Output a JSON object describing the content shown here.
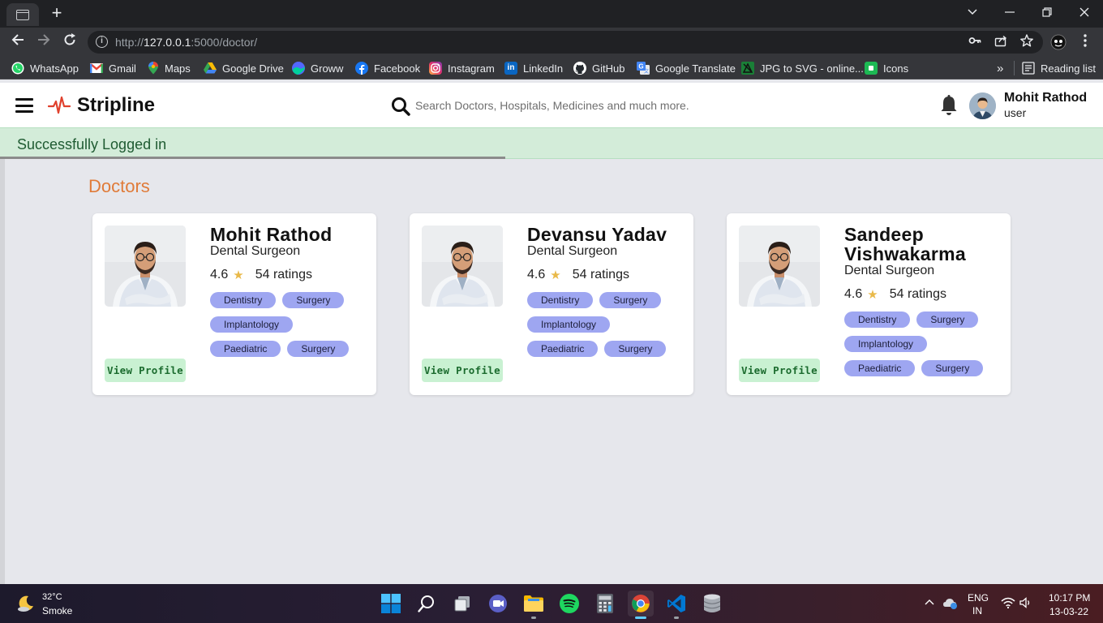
{
  "browser": {
    "url_scheme": "http://",
    "url_host": "127.0.0.1",
    "url_path": ":5000/doctor/",
    "bookmarks": [
      {
        "label": "WhatsApp"
      },
      {
        "label": "Gmail"
      },
      {
        "label": "Maps"
      },
      {
        "label": "Google Drive"
      },
      {
        "label": "Groww"
      },
      {
        "label": "Facebook"
      },
      {
        "label": "Instagram"
      },
      {
        "label": "LinkedIn"
      },
      {
        "label": "GitHub"
      },
      {
        "label": "Google Translate"
      },
      {
        "label": "JPG to SVG - online..."
      },
      {
        "label": "Icons"
      }
    ],
    "overflow_label": "»",
    "reading_list_label": "Reading list"
  },
  "header": {
    "brand": "Stripline",
    "search_placeholder": "Search Doctors, Hospitals, Medicines and much more.",
    "user_name": "Mohit Rathod",
    "user_role": "user"
  },
  "alert": {
    "message": "Successfully Logged in",
    "progress_fraction": 0.458
  },
  "main": {
    "section_title": "Doctors",
    "doctors": [
      {
        "name": "Mohit Rathod",
        "specialty": "Dental Surgeon",
        "rating": "4.6",
        "ratings_count": "54 ratings",
        "tags": [
          "Dentistry",
          "Surgery",
          "Implantology",
          "Paediatric",
          "Surgery"
        ],
        "button_label": "View Profile"
      },
      {
        "name": "Devansu Yadav",
        "specialty": "Dental Surgeon",
        "rating": "4.6",
        "ratings_count": "54 ratings",
        "tags": [
          "Dentistry",
          "Surgery",
          "Implantology",
          "Paediatric",
          "Surgery"
        ],
        "button_label": "View Profile"
      },
      {
        "name": "Sandeep Vishwakarma",
        "specialty": "Dental Surgeon",
        "rating": "4.6",
        "ratings_count": "54 ratings",
        "tags": [
          "Dentistry",
          "Surgery",
          "Implantology",
          "Paediatric",
          "Surgery"
        ],
        "button_label": "View Profile"
      }
    ]
  },
  "taskbar": {
    "weather_temp": "32°C",
    "weather_desc": "Smoke",
    "lang_top": "ENG",
    "lang_bottom": "IN",
    "time": "10:17 PM",
    "date": "13-03-22"
  },
  "colors": {
    "accent_orange": "#e07b39",
    "tag_bg": "#9ea6f1",
    "button_bg": "#c9f1d2",
    "alert_bg": "#d3ecd9",
    "logo_red": "#e0412d"
  }
}
